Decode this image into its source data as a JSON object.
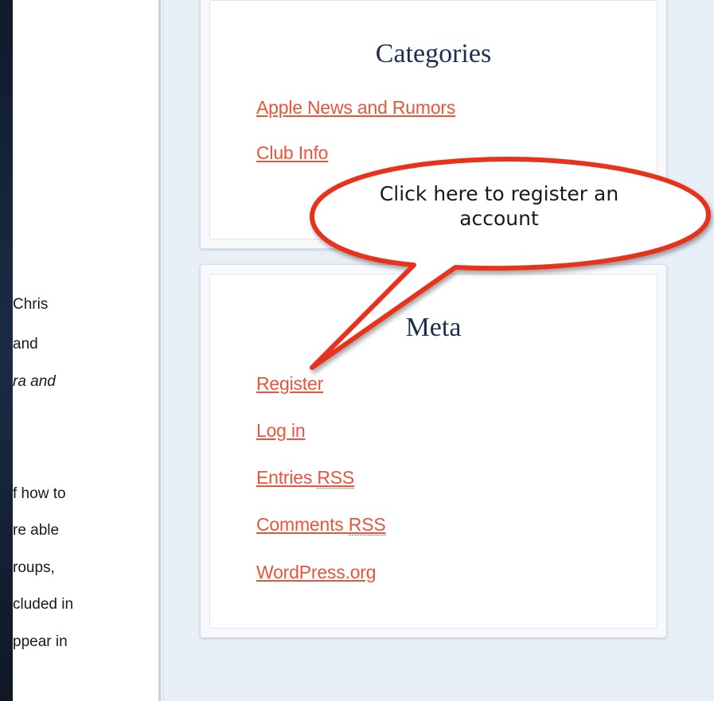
{
  "main_content": {
    "lines": [
      {
        "text": "Chris",
        "italic": false
      },
      {
        "text": "and",
        "italic": false
      },
      {
        "text": "ra and",
        "italic": true
      },
      {
        "text": "f how to",
        "italic": false
      },
      {
        "text": "re able",
        "italic": false
      },
      {
        "text": "roups,",
        "italic": false
      },
      {
        "text": "cluded in",
        "italic": false
      },
      {
        "text": "ppear in",
        "italic": false
      }
    ]
  },
  "categories_widget": {
    "title": "Categories",
    "links": [
      "Apple News and Rumors",
      "Club Info"
    ]
  },
  "meta_widget": {
    "title": "Meta",
    "register": "Register",
    "login": "Log in",
    "entries_prefix": "Entries ",
    "entries_abbr": "RSS",
    "comments_prefix": "Comments ",
    "comments_abbr": "RSS",
    "wordpress": "WordPress.org"
  },
  "callout": {
    "line1": "Click here to register an",
    "line2": "account"
  },
  "colors": {
    "link": "#e8553a",
    "title": "#1f2e4f",
    "callout_stroke": "#e8301e"
  }
}
